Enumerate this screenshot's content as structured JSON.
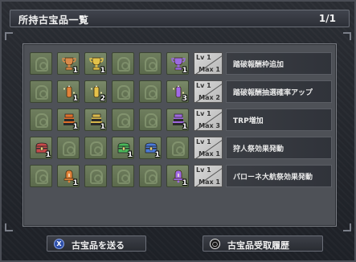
{
  "header": {
    "title": "所持古宝品一覧",
    "page": "1/1"
  },
  "rows": [
    {
      "label": "踏破報酬枠追加",
      "lv": "Lv 1",
      "max": "Max 1",
      "slots": [
        {
          "icon": "empty",
          "count": ""
        },
        {
          "icon": "bronze-trophy-icon",
          "color": "#d88a4a",
          "count": "1"
        },
        {
          "icon": "gold-trophy-icon",
          "color": "#e2c14a",
          "count": "1"
        },
        {
          "icon": "empty",
          "count": ""
        },
        {
          "icon": "empty",
          "count": ""
        },
        {
          "icon": "purple-trophy-icon",
          "color": "#9a6ae0",
          "count": "1"
        }
      ]
    },
    {
      "label": "踏破報酬抽選確率アップ",
      "lv": "Lv 1",
      "max": "Max 2",
      "slots": [
        {
          "icon": "empty",
          "count": ""
        },
        {
          "icon": "orange-sparkle-icon",
          "color": "#e0823a",
          "count": "1"
        },
        {
          "icon": "gold-sparkle-icon",
          "color": "#e6c24a",
          "count": "2"
        },
        {
          "icon": "empty",
          "count": ""
        },
        {
          "icon": "empty",
          "count": ""
        },
        {
          "icon": "purple-sparkle-icon",
          "color": "#a06ae6",
          "count": "3"
        }
      ]
    },
    {
      "label": "TRP増加",
      "lv": "Lv 1",
      "max": "Max 3",
      "slots": [
        {
          "icon": "empty",
          "count": ""
        },
        {
          "icon": "orange-book-stack-icon",
          "color": "#e0702a",
          "count": "1"
        },
        {
          "icon": "gold-book-stack-icon",
          "color": "#d8b84a",
          "count": "1"
        },
        {
          "icon": "empty",
          "count": ""
        },
        {
          "icon": "empty",
          "count": ""
        },
        {
          "icon": "purple-book-stack-icon",
          "color": "#a068e0",
          "count": "1"
        }
      ]
    },
    {
      "label": "狩人祭効果発動",
      "lv": "Lv 1",
      "max": "Max 1",
      "slots": [
        {
          "icon": "red-chest-icon",
          "color": "#c84a4a",
          "count": "1"
        },
        {
          "icon": "empty",
          "count": ""
        },
        {
          "icon": "empty",
          "count": ""
        },
        {
          "icon": "green-chest-icon",
          "color": "#4ab85a",
          "count": "1"
        },
        {
          "icon": "blue-chest-icon",
          "color": "#4a7ad8",
          "count": "1"
        },
        {
          "icon": "empty",
          "count": ""
        }
      ]
    },
    {
      "label": "パローネ大航祭効果発動",
      "lv": "Lv 1",
      "max": "Max 1",
      "slots": [
        {
          "icon": "empty",
          "count": ""
        },
        {
          "icon": "orange-bell-icon",
          "color": "#e0823a",
          "count": "1"
        },
        {
          "icon": "empty",
          "count": ""
        },
        {
          "icon": "empty",
          "count": ""
        },
        {
          "icon": "empty",
          "count": ""
        },
        {
          "icon": "purple-bell-icon",
          "color": "#a06ae6",
          "count": "1"
        }
      ]
    }
  ],
  "buttons": {
    "send": {
      "key": "X",
      "label": "古宝品を送る"
    },
    "history": {
      "key": "○",
      "label": "古宝品受取履歴"
    }
  }
}
